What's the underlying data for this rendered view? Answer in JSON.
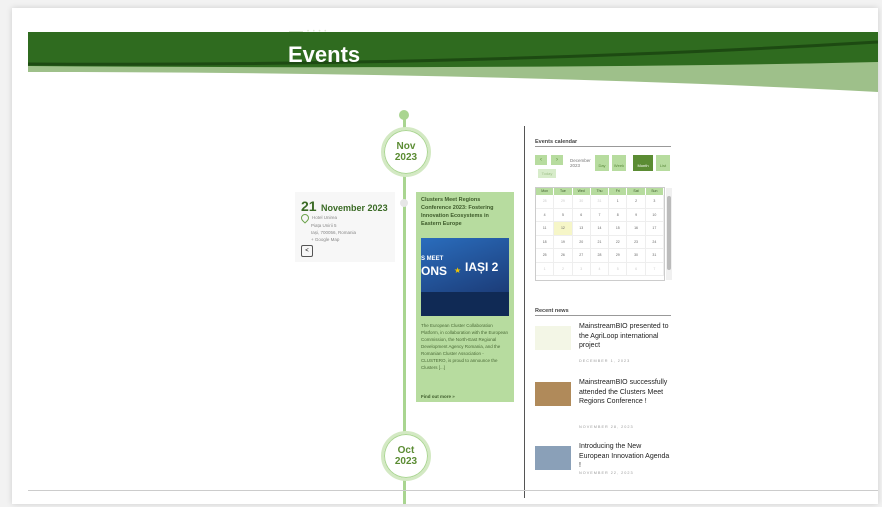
{
  "header": {
    "breadcrumb": "• • • •",
    "title": "Events"
  },
  "timeline": {
    "months": [
      {
        "month": "Nov",
        "year": "2023"
      },
      {
        "month": "Oct",
        "year": "2023"
      }
    ]
  },
  "event": {
    "day": "21",
    "month_year": "November 2023",
    "venue": "Hotel Unirea",
    "address": [
      "Piața Unirii 5",
      "Iași, 700056, Romania"
    ],
    "map_link": "+ Google Map",
    "title": "Clusters Meet Regions Conference 2023: Fostering Innovation Ecosystems in Eastern Europe",
    "image_text": {
      "meet": "S MEET",
      "ons": "ONS",
      "iasi": "IAȘI 2"
    },
    "description": "The European Cluster Collaboration Platform, in collaboration with the European Commission, the North-East Regional Development Agency Romania, and the Romanian Cluster Association - CLUSTERO, is proud to announce the Clusters [...]",
    "read_more": "Find out more »"
  },
  "calendar": {
    "title": "Events calendar",
    "prev": "‹",
    "next": "›",
    "month_label": "December 2023",
    "today": "Today",
    "views": [
      "Day",
      "Week",
      "Month",
      "List"
    ],
    "weekdays": [
      "Mon",
      "Tue",
      "Wed",
      "Thu",
      "Fri",
      "Sat",
      "Sun"
    ],
    "weeks": [
      [
        "28",
        "29",
        "30",
        "31",
        "1",
        "2",
        "3"
      ],
      [
        "4",
        "5",
        "6",
        "7",
        "8",
        "9",
        "10"
      ],
      [
        "11",
        "12",
        "13",
        "14",
        "15",
        "16",
        "17"
      ],
      [
        "18",
        "19",
        "20",
        "21",
        "22",
        "23",
        "24"
      ],
      [
        "25",
        "26",
        "27",
        "28",
        "29",
        "30",
        "31"
      ],
      [
        "1",
        "2",
        "3",
        "4",
        "5",
        "6",
        "7"
      ]
    ]
  },
  "news": {
    "title": "Recent news",
    "items": [
      {
        "title": "MainstreamBIO presented to the AgriLoop international project",
        "date": "DECEMBER 1, 2023"
      },
      {
        "title": "MainstreamBIO successfully attended the Clusters Meet Regions Conference !",
        "date": "NOVEMBER 28, 2023"
      },
      {
        "title": "Introducing the New European Innovation Agenda !",
        "date": "NOVEMBER 22, 2023"
      }
    ]
  },
  "colors": {
    "brand_dark": "#2f6b1f",
    "brand_light": "#b7dc9f",
    "accent": "#5b8c33"
  }
}
